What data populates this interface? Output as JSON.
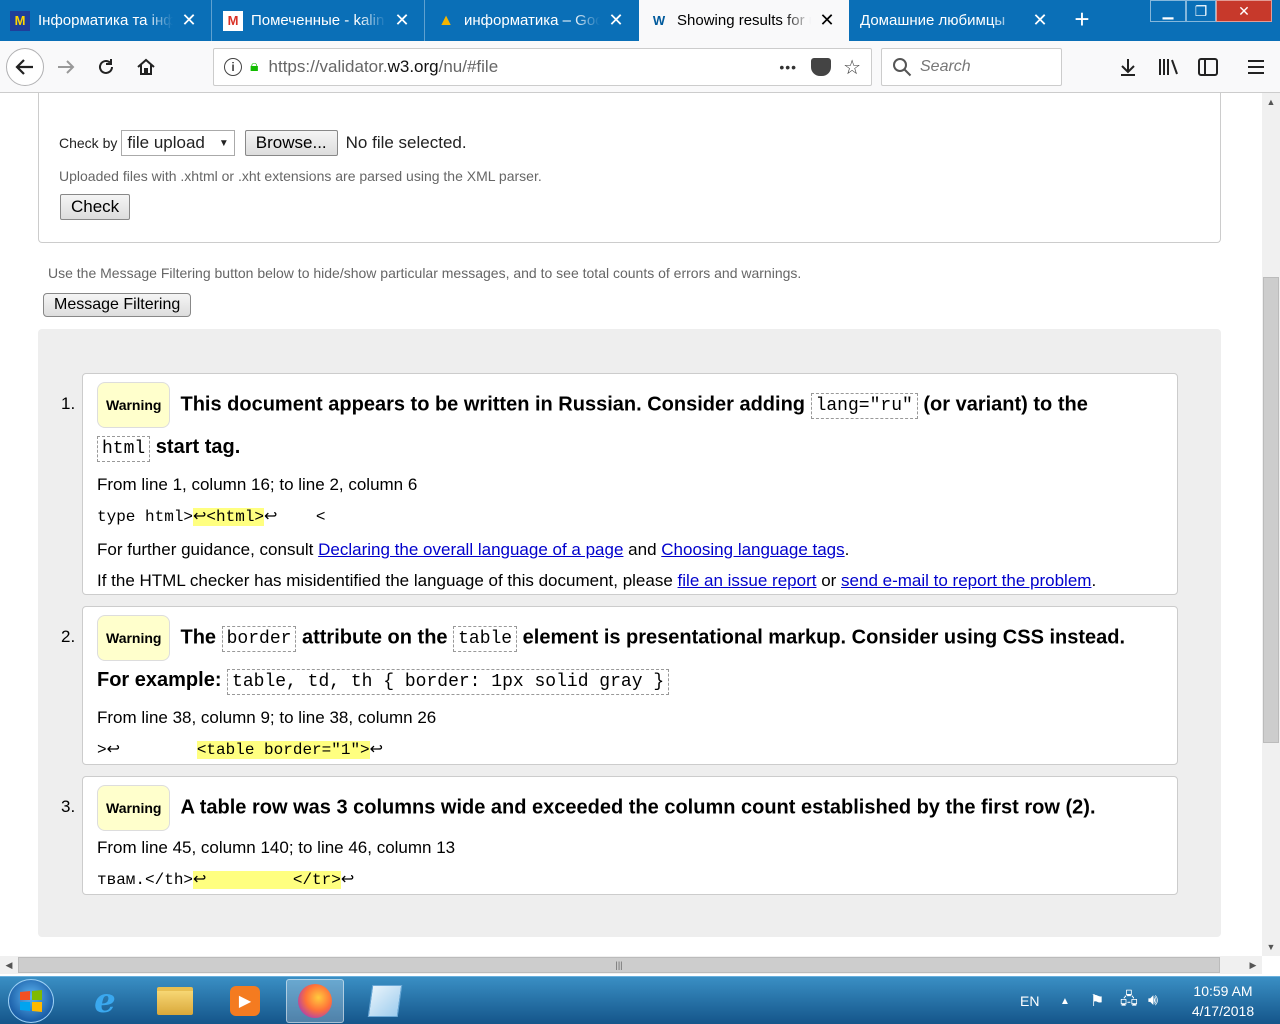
{
  "browser": {
    "tabs": [
      {
        "title": "Інформатика та інф",
        "favicon_text": "M",
        "favicon_color": "#ffd700"
      },
      {
        "title": "Помеченные - kalin",
        "favicon_text": "M",
        "favicon_color": "#d93025"
      },
      {
        "title": "информатика – Goo",
        "favicon_text": "▲",
        "favicon_color": "#f4b400"
      },
      {
        "title": "Showing results for u",
        "favicon_text": "W",
        "favicon_color": "#005a9c",
        "active": true
      },
      {
        "title": "Домашние любимцы",
        "favicon_text": "",
        "favicon_color": ""
      }
    ],
    "new_tab_label": "+",
    "url": {
      "prefix": "https://validator.",
      "domain": "w3.org",
      "path": "/nu/#file"
    },
    "search_placeholder": "Search",
    "url_more": "•••"
  },
  "form": {
    "check_by_label": "Check by",
    "check_by_value": "file upload",
    "browse_label": "Browse...",
    "no_file_text": "No file selected.",
    "xml_hint": "Uploaded files with .xhtml or .xht extensions are parsed using the XML parser.",
    "check_button": "Check"
  },
  "filter": {
    "note": "Use the Message Filtering button below to hide/show particular messages, and to see total counts of errors and warnings.",
    "button_label": "Message Filtering"
  },
  "messages": [
    {
      "number": "1.",
      "badge": "Warning",
      "title_a": "This document appears to be written in Russian. Consider adding",
      "code_a": "lang=\"ru\"",
      "title_b": "(or variant) to the",
      "code_b": "html",
      "title_c": "start tag.",
      "location": "From line 1, column 16; to line 2, column 6",
      "extract_pre": "type html>",
      "extract_hl": "↩<html>",
      "extract_post": "↩    <",
      "guidance_prefix": "For further guidance, consult",
      "link1": "Declaring the overall language of a page",
      "guidance_and": "and",
      "link2": "Choosing language tags",
      "guidance_end": ".",
      "misid_prefix": "If the HTML checker has misidentified the language of this document, please",
      "link3": "file an issue report",
      "misid_or": "or",
      "link4": "send e-mail to report the problem",
      "misid_end": "."
    },
    {
      "number": "2.",
      "badge": "Warning",
      "title_a": "The",
      "code_a": "border",
      "title_b": "attribute on the",
      "code_b": "table",
      "title_c": "element is presentational markup. Consider using CSS instead.",
      "title_d": "For example:",
      "code_c": "table, td, th { border: 1px solid gray }",
      "location": "From line 38, column 9; to line 38, column 26",
      "extract_pre": ">↩        ",
      "extract_hl": "<table border=\"1\">",
      "extract_post": "↩"
    },
    {
      "number": "3.",
      "badge": "Warning",
      "title_a": "A table row was 3 columns wide and exceeded the column count established by the first row (2).",
      "location": "From line 45, column 140; to line 46, column 13",
      "extract_pre": "твам.</th>",
      "extract_hl": "↩         </tr>",
      "extract_post": "↩"
    }
  ],
  "taskbar": {
    "lang": "EN",
    "time": "10:59 AM",
    "date": "4/17/2018"
  }
}
